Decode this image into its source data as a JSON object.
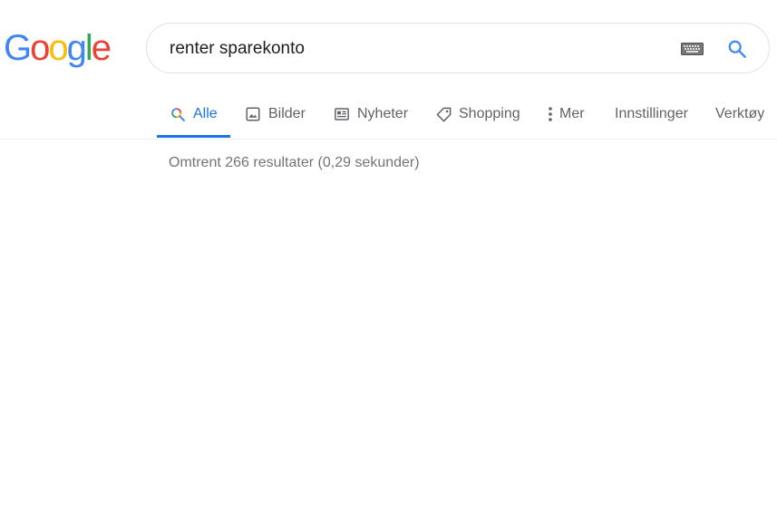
{
  "logo": {
    "letters": [
      "G",
      "o",
      "o",
      "g",
      "l",
      "e"
    ],
    "colors": [
      "#4285F4",
      "#EA4335",
      "#FBBC05",
      "#4285F4",
      "#34A853",
      "#EA4335"
    ]
  },
  "search": {
    "query": "renter sparekonto",
    "keyboard_icon": "keyboard-icon",
    "search_icon": "search-icon"
  },
  "tabs": [
    {
      "label": "Alle",
      "icon": "search-icon",
      "active": true
    },
    {
      "label": "Bilder",
      "icon": "image-icon",
      "active": false
    },
    {
      "label": "Nyheter",
      "icon": "news-icon",
      "active": false
    },
    {
      "label": "Shopping",
      "icon": "tag-icon",
      "active": false
    },
    {
      "label": "Mer",
      "icon": "more-vert-icon",
      "active": false
    },
    {
      "label": "Innstillinger",
      "icon": "",
      "active": false
    },
    {
      "label": "Verktøy",
      "icon": "",
      "active": false
    }
  ],
  "results": {
    "stats": "Omtrent 266 resultater (0,29 sekunder)"
  },
  "colors": {
    "accent": "#1a73e8",
    "tab_text": "#5f6368",
    "stats_text": "#70757a"
  }
}
